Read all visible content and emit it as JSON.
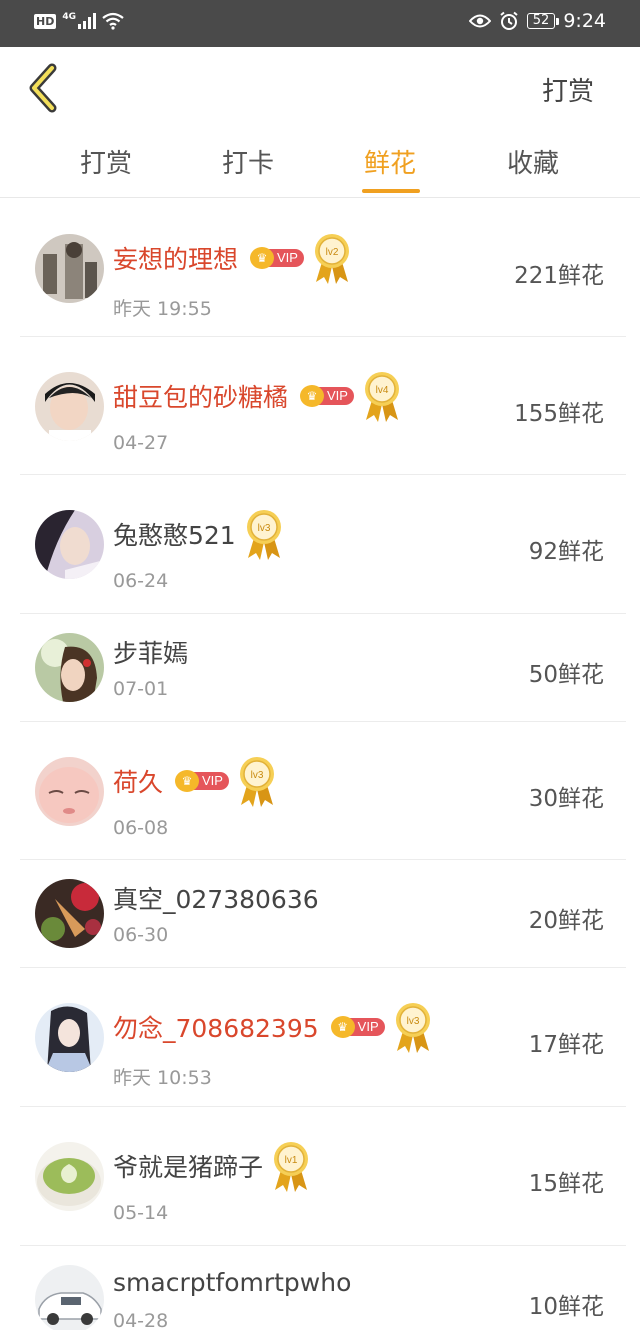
{
  "status_bar": {
    "network_hd": "HD",
    "network_gen": "4G",
    "battery": "52",
    "time": "9:24"
  },
  "header": {
    "action_label": "打赏"
  },
  "tabs": [
    {
      "label": "打赏"
    },
    {
      "label": "打卡"
    },
    {
      "label": "鲜花"
    },
    {
      "label": "收藏"
    }
  ],
  "active_tab": "鲜花",
  "accent_color": "#f0a020",
  "vip_name_color": "#d9472c",
  "vip_label": "VIP",
  "list": [
    {
      "name": "妄想的理想",
      "vip": true,
      "level": "lv2",
      "date": "昨天 19:55",
      "amount": "221鲜花"
    },
    {
      "name": "甜豆包的砂糖橘",
      "vip": true,
      "level": "lv4",
      "date": "04-27",
      "amount": "155鲜花"
    },
    {
      "name": "兔憨憨521",
      "vip": false,
      "level": "lv3",
      "date": "06-24",
      "amount": "92鲜花"
    },
    {
      "name": "步菲嫣",
      "vip": false,
      "level": "",
      "date": "07-01",
      "amount": "50鲜花"
    },
    {
      "name": "荷久",
      "vip": true,
      "level": "lv3",
      "date": "06-08",
      "amount": "30鲜花"
    },
    {
      "name": "真空_027380636",
      "vip": false,
      "level": "",
      "date": "06-30",
      "amount": "20鲜花"
    },
    {
      "name": "勿念_708682395",
      "vip": true,
      "level": "lv3",
      "date": "昨天 10:53",
      "amount": "17鲜花"
    },
    {
      "name": "爷就是猪蹄子",
      "vip": false,
      "level": "lv1",
      "date": "05-14",
      "amount": "15鲜花"
    },
    {
      "name": "smacrptfomrtpwho",
      "vip": false,
      "level": "",
      "date": "04-28",
      "amount": "10鲜花"
    }
  ]
}
